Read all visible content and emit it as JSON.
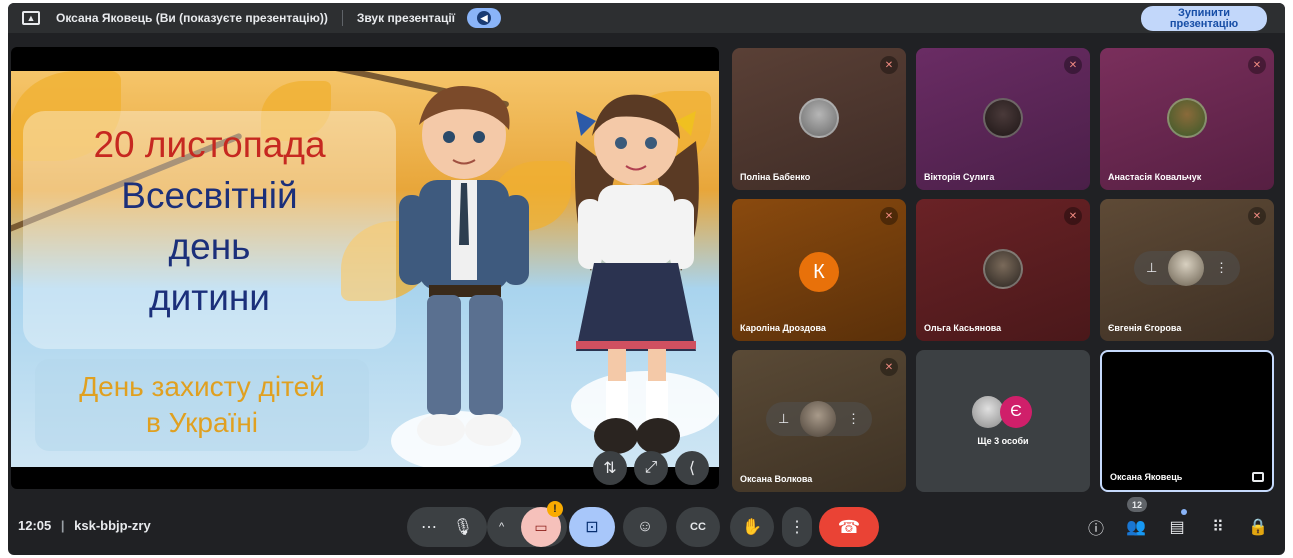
{
  "banner": {
    "presenter_text": "Оксана Яковець (Ви (показуєте презентацію))",
    "sound_label": "Звук презентації",
    "stop_button_line1": "Зупинити",
    "stop_button_line2": "презентацію"
  },
  "slide": {
    "date_line": "20 листопада",
    "line2": "Всесвітній",
    "line3": "день",
    "line4": "дитини",
    "sub_line1": "День захисту дітей",
    "sub_line2": "в Україні"
  },
  "participants": [
    {
      "name": "Поліна Бабенко"
    },
    {
      "name": "Вікторія Сулига"
    },
    {
      "name": "Анастасія Ковальчук"
    },
    {
      "name": "Кароліна Дроздова",
      "initial": "К"
    },
    {
      "name": "Ольга Касьянова"
    },
    {
      "name": "Євгенія Єгорова"
    },
    {
      "name": "Оксана Волкова"
    },
    {
      "name": "Ще 3 особи",
      "initial": "Є"
    },
    {
      "name": "Оксана Яковець"
    }
  ],
  "bottom_bar": {
    "time": "12:05",
    "meeting_code": "ksk-bbjp-zry",
    "people_count": "12"
  },
  "colors": {
    "background": "#202124",
    "accent": "#8ab4f8",
    "end_call": "#ea4335"
  }
}
